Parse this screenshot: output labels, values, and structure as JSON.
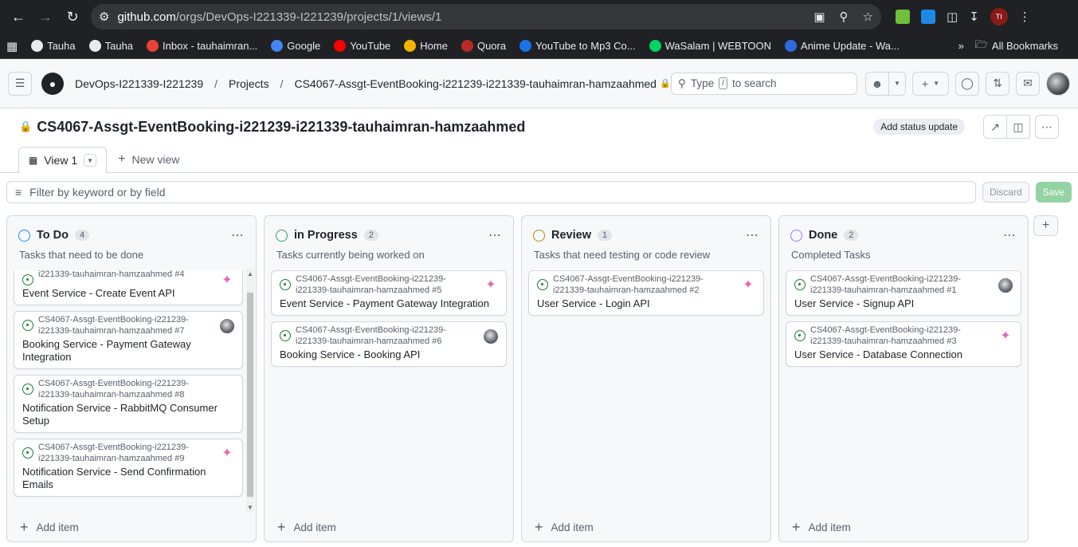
{
  "browser": {
    "url_host": "github.com",
    "url_path": "/orgs/DevOps-I221339-I221239/projects/1/views/1",
    "profile_initials": "TI",
    "bookmarks": [
      {
        "label": "Tauha",
        "color": "#e8eaed"
      },
      {
        "label": "Tauha",
        "color": "#e8eaed"
      },
      {
        "label": "Inbox - tauhaimran...",
        "color": "#ea4335"
      },
      {
        "label": "Google",
        "color": "#4285f4"
      },
      {
        "label": "YouTube",
        "color": "#ff0000"
      },
      {
        "label": "Home",
        "color": "#f4b400"
      },
      {
        "label": "Quora",
        "color": "#b92b27"
      },
      {
        "label": "YouTube to Mp3 Co...",
        "color": "#1a73e8"
      },
      {
        "label": "WaSalam | WEBTOON",
        "color": "#00d564"
      },
      {
        "label": "Anime Update - Wa...",
        "color": "#2d6cdf"
      }
    ],
    "overflow": "»",
    "all_bookmarks": "All Bookmarks"
  },
  "header": {
    "org": "DevOps-I221339-I221239",
    "projects": "Projects",
    "project_name": "CS4067-Assgt-EventBooking-i221239-i221339-tauhaimran-hamzaahmed",
    "search_pre": "Type",
    "search_key": "/",
    "search_post": "to search"
  },
  "project": {
    "title": "CS4067-Assgt-EventBooking-i221239-i221339-tauhaimran-hamzaahmed",
    "status_update": "Add status update"
  },
  "views": {
    "active": "View 1",
    "new": "New view"
  },
  "filter": {
    "placeholder": "Filter by keyword or by field",
    "discard": "Discard",
    "save": "Save"
  },
  "columns": [
    {
      "name": "To Do",
      "count": "4",
      "desc": "Tasks that need to be done",
      "color": "#218bff",
      "cards": [
        {
          "meta": "i221339-tauhaimran-hamzaahmed #4",
          "title": "Event Service - Create Event API",
          "assignee": "pink"
        },
        {
          "meta": "CS4067-Assgt-EventBooking-i221239-i221339-tauhaimran-hamzaahmed #7",
          "title": "Booking Service - Payment Gateway Integration",
          "assignee": "photo"
        },
        {
          "meta": "CS4067-Assgt-EventBooking-i221239-i221339-tauhaimran-hamzaahmed #8",
          "title": "Notification Service - RabbitMQ Consumer Setup",
          "assignee": ""
        },
        {
          "meta": "CS4067-Assgt-EventBooking-i221239-i221339-tauhaimran-hamzaahmed #9",
          "title": "Notification Service - Send Confirmation Emails",
          "assignee": "pink"
        }
      ],
      "add": "Add item"
    },
    {
      "name": "in Progress",
      "count": "2",
      "desc": "Tasks currently being worked on",
      "color": "#2da44e",
      "cards": [
        {
          "meta": "CS4067-Assgt-EventBooking-i221239-i221339-tauhaimran-hamzaahmed #5",
          "title": "Event Service - Payment Gateway Integration",
          "assignee": "pink"
        },
        {
          "meta": "CS4067-Assgt-EventBooking-i221239-i221339-tauhaimran-hamzaahmed #6",
          "title": "Booking Service - Booking API",
          "assignee": "photo"
        }
      ],
      "add": "Add item"
    },
    {
      "name": "Review",
      "count": "1",
      "desc": "Tasks that need testing or code review",
      "color": "#bf8700",
      "cards": [
        {
          "meta": "CS4067-Assgt-EventBooking-i221239-i221339-tauhaimran-hamzaahmed #2",
          "title": "User Service - Login API",
          "assignee": "pink"
        }
      ],
      "add": "Add item"
    },
    {
      "name": "Done",
      "count": "2",
      "desc": "Completed Tasks",
      "color": "#a475f9",
      "cards": [
        {
          "meta": "CS4067-Assgt-EventBooking-i221239-i221339-tauhaimran-hamzaahmed #1",
          "title": "User Service - Signup API",
          "assignee": "photo"
        },
        {
          "meta": "CS4067-Assgt-EventBooking-i221239-i221339-tauhaimran-hamzaahmed #3",
          "title": "User Service - Database Connection",
          "assignee": "pink"
        }
      ],
      "add": "Add item"
    }
  ]
}
